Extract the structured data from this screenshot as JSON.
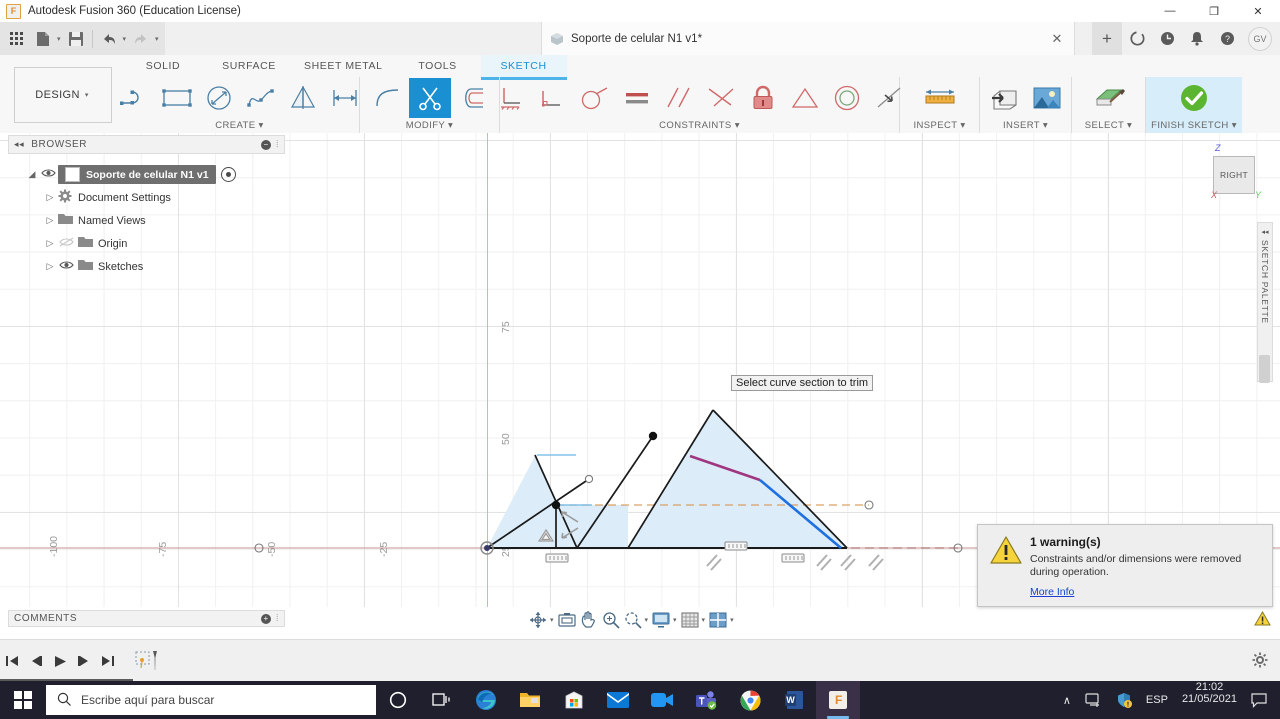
{
  "window": {
    "title": "Autodesk Fusion 360 (Education License)",
    "logo_letter": "F",
    "minimize": "—",
    "maximize": "❐",
    "close": "✕"
  },
  "quick_access": {
    "grid_icon": "app-grid-icon",
    "new_label": "new-document-icon",
    "save_label": "save-icon",
    "undo_label": "undo-icon",
    "redo_label": "redo-icon"
  },
  "document_tab": {
    "name": "Soporte de celular N1 v1*",
    "close": "✕",
    "add": "+"
  },
  "right_tools": {
    "job_status": "job-status-icon",
    "recent": "recent-icon",
    "notifications": "bell-icon",
    "help": "help-icon",
    "avatar_initials": "GV"
  },
  "ribbon": {
    "workspace_label": "DESIGN",
    "workspace_caret": "▾",
    "tabs": [
      {
        "label": "SOLID",
        "active": false
      },
      {
        "label": "SURFACE",
        "active": false
      },
      {
        "label": "SHEET METAL",
        "active": false
      },
      {
        "label": "TOOLS",
        "active": false
      },
      {
        "label": "SKETCH",
        "active": true
      }
    ],
    "panels": [
      {
        "label": "CREATE",
        "caret": "▾"
      },
      {
        "label": "MODIFY",
        "caret": "▾"
      },
      {
        "label": "CONSTRAINTS",
        "caret": "▾"
      },
      {
        "label": "INSPECT",
        "caret": "▾"
      },
      {
        "label": "INSERT",
        "caret": "▾"
      },
      {
        "label": "SELECT",
        "caret": "▾"
      },
      {
        "label": "FINISH SKETCH",
        "caret": "▾"
      }
    ],
    "create_tools": [
      "line-icon",
      "rectangle-icon",
      "circle-icon",
      "spline-icon",
      "mirror-icon",
      "sketch-dimension-icon"
    ],
    "modify_tools": [
      "fillet-icon",
      "trim-icon",
      "offset-icon"
    ],
    "constraint_tools": [
      "perpendicular-icon",
      "tangent-icon",
      "equal-icon",
      "parallel-icon",
      "midpoint-icon",
      "fix-lock-icon",
      "symmetry-icon",
      "concentric-icon",
      "collinear-icon"
    ],
    "constraint_extra": [
      "horizontal-vertical-icon"
    ]
  },
  "browser": {
    "header": "BROWSER",
    "collapse_icon": "◂◂",
    "minus_icon": "−",
    "root": {
      "label": "Soporte de celular N1 v1"
    },
    "items": [
      {
        "label": "Document Settings",
        "icon": "gear-icon",
        "eye": false
      },
      {
        "label": "Named Views",
        "icon": "folder-icon",
        "eye": false
      },
      {
        "label": "Origin",
        "icon": "folder-icon",
        "eye": true,
        "eye_off": true
      },
      {
        "label": "Sketches",
        "icon": "folder-icon",
        "eye": true,
        "eye_off": false
      }
    ]
  },
  "canvas": {
    "tooltip": "Select curve section to trim",
    "y_axis_labels": [
      "75",
      "50",
      "25"
    ],
    "x_axis_labels": [
      "-100",
      "-75",
      "-50",
      "-25"
    ],
    "viewcube_face": "RIGHT",
    "axis_z": "Z",
    "axis_x": "X",
    "axis_y": "Y",
    "sketch_palette_label": "SKETCH PALETTE",
    "sketch_palette_collapse": "◂◂",
    "colors": {
      "profile_fill": "#dcecf8",
      "selected_curve": "#1e6fe0",
      "highlight_curve": "#a03a7a",
      "construction": "#d9a066",
      "x_axis": "#c98f8f",
      "y_axis": "#9ed39e"
    }
  },
  "toast": {
    "title": "1 warning(s)",
    "message": "Constraints and/or dimensions were removed during operation.",
    "link": "More Info",
    "icon": "warning-triangle-icon"
  },
  "comments": {
    "label": "COMMENTS",
    "plus_icon": "+"
  },
  "nav_bar": {
    "items": [
      "orbit-icon",
      "pan-look-at-icon",
      "pan-icon",
      "zoom-window-icon",
      "zoom-icon",
      "display-settings-icon",
      "grid-snaps-icon",
      "viewports-icon"
    ],
    "caret": "▾"
  },
  "timeline": {
    "buttons": [
      "skip-to-beginning-icon",
      "step-back-icon",
      "play-icon",
      "step-forward-icon",
      "skip-to-end-icon"
    ],
    "sketch_feature": "sketch-feature-icon",
    "settings_icon": "gear-icon"
  },
  "taskbar": {
    "start": "windows-start-icon",
    "search_placeholder": "Escribe aquí para buscar",
    "search_icon": "search-icon",
    "items": [
      "cortana-icon",
      "task-view-icon",
      "edge-icon",
      "file-explorer-icon",
      "microsoft-store-icon",
      "mail-icon",
      "video-icon",
      "teams-icon",
      "chrome-icon",
      "word-icon",
      "fusion360-icon"
    ],
    "tray": {
      "chevron": "∧",
      "network": "network-icon",
      "security": "security-shield-icon",
      "language": "ESP",
      "time": "21:02",
      "date": "21/05/2021",
      "action_center": "action-center-icon"
    }
  }
}
